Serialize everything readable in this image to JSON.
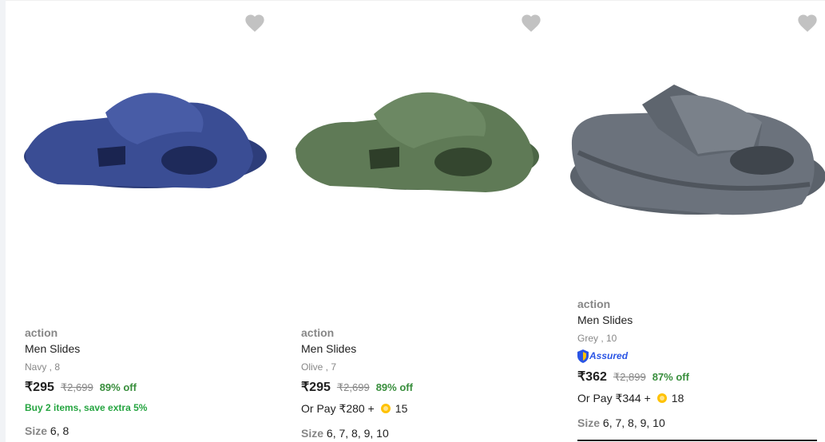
{
  "products": [
    {
      "brand": "action",
      "title": "Men Slides",
      "variant": "Navy , 8",
      "price": "₹295",
      "mrp": "₹2,699",
      "discount": "89% off",
      "offer": "Buy 2 items, save extra 5%",
      "size_label": "Size",
      "sizes": "6, 8",
      "color": "#34478a"
    },
    {
      "brand": "action",
      "title": "Men Slides",
      "variant": "Olive , 7",
      "price": "₹295",
      "mrp": "₹2,699",
      "discount": "89% off",
      "pay_text": "Or Pay ₹280 +",
      "coins": "15",
      "size_label": "Size",
      "sizes": "6, 7, 8, 9, 10",
      "color": "#5f7a56"
    },
    {
      "brand": "action",
      "title": "Men Slides",
      "variant": "Grey , 10",
      "assured": "Assured",
      "price": "₹362",
      "mrp": "₹2,899",
      "discount": "87% off",
      "pay_text": "Or Pay ₹344 +",
      "coins": "18",
      "size_label": "Size",
      "sizes": "6, 7, 8, 9, 10",
      "color": "#6b727c"
    }
  ],
  "colors": {
    "wishlist": "#c2c2c2",
    "discount": "#388e3c",
    "assured": "#2a55e5"
  }
}
